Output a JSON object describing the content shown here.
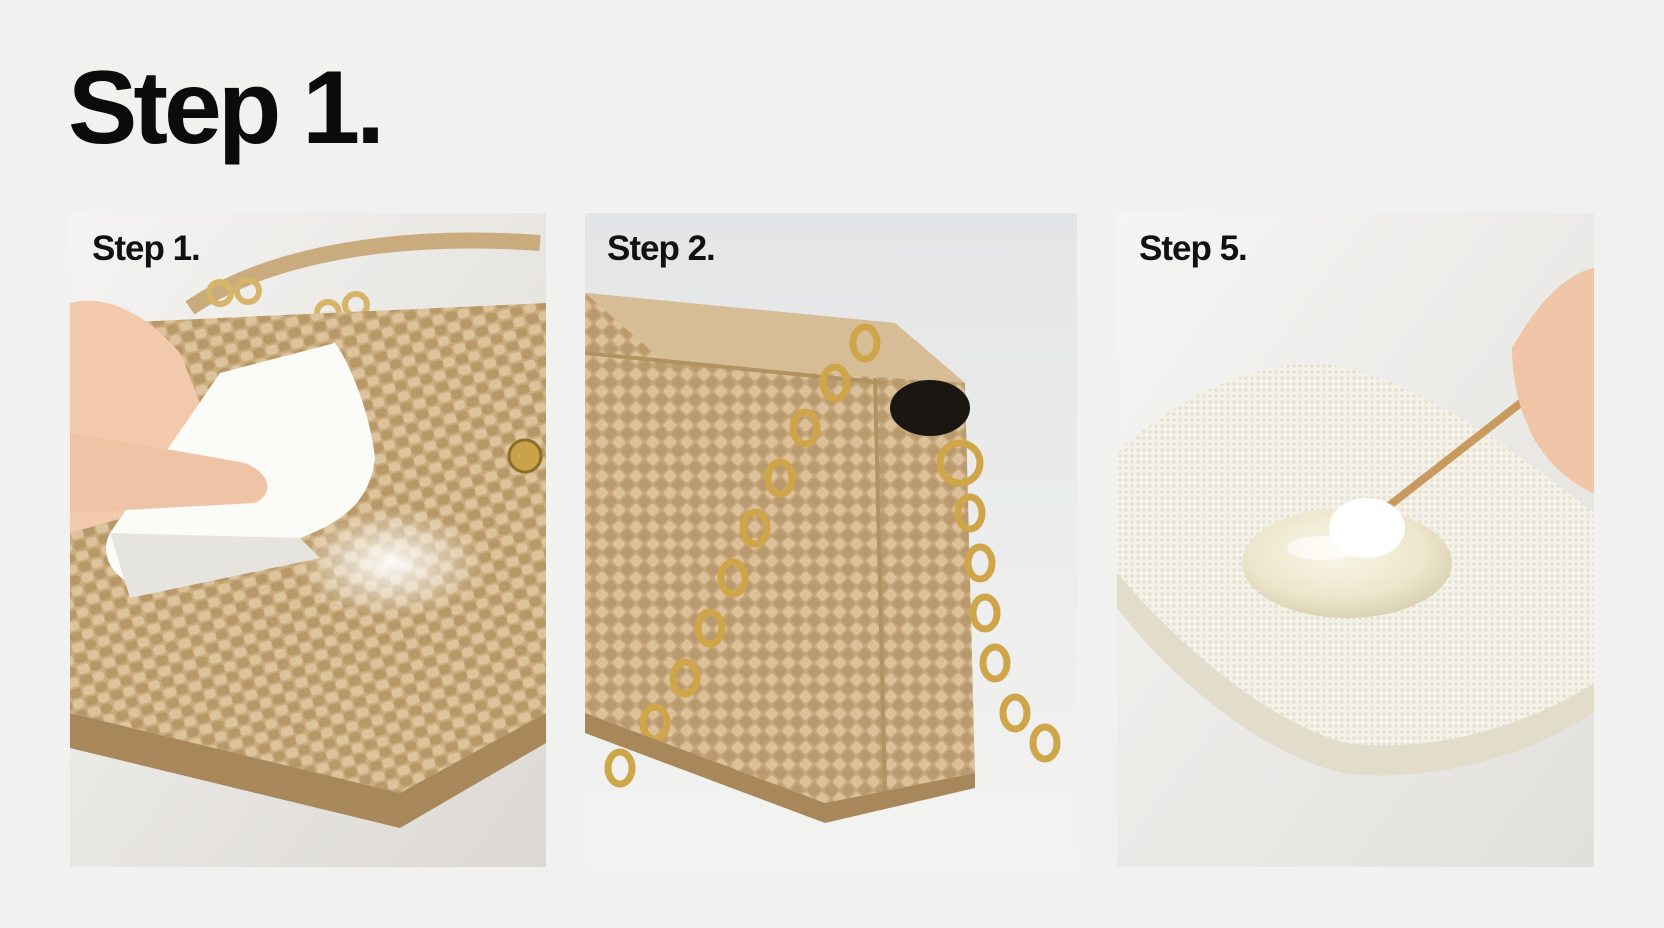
{
  "title": "Step 1.",
  "panels": [
    {
      "label": "Step 1.",
      "illustration": "woven bag with white cloth and powder"
    },
    {
      "label": "Step 2.",
      "illustration": "woven bag with gold chain strap"
    },
    {
      "label": "Step 5.",
      "illustration": "cotton swab applying gel on white towel"
    }
  ],
  "colors": {
    "background": "#f1f1ef",
    "text": "#0b0b0b",
    "weave": "#d3b88f",
    "gold": "#c9a24a",
    "towel": "#f6f4ee"
  }
}
